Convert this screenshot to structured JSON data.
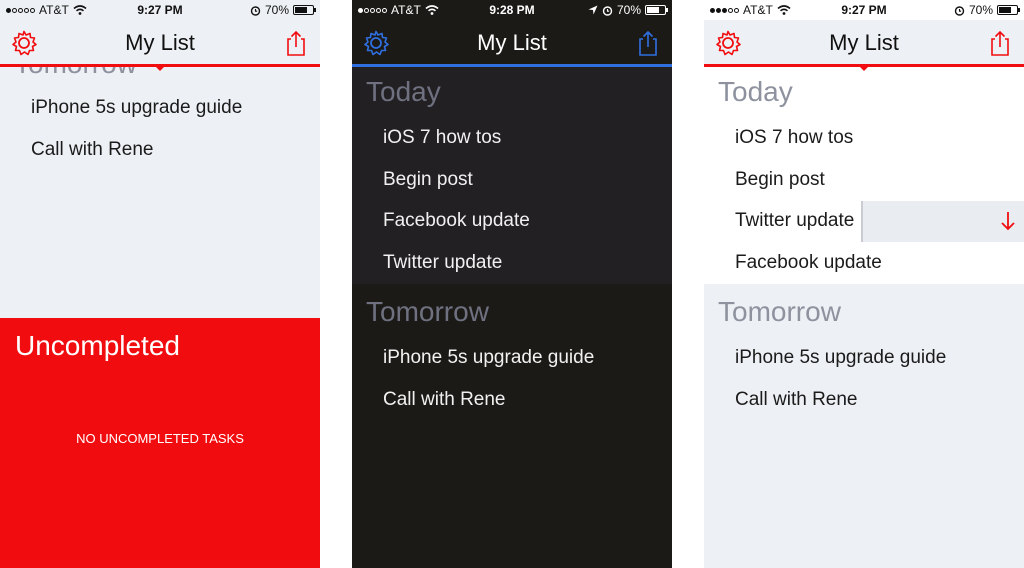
{
  "phones": [
    {
      "status": {
        "carrier": "AT&T",
        "time": "9:27 PM",
        "battery": "70%",
        "battery_level": 0.7
      },
      "nav": {
        "title": "My List"
      },
      "partial_section": "Tomorrow",
      "items": [
        "iPhone 5s upgrade guide",
        "Call with Rene"
      ],
      "uncompleted": {
        "title": "Uncompleted",
        "empty_text": "NO UNCOMPLETED TASKS"
      }
    },
    {
      "status": {
        "carrier": "AT&T",
        "time": "9:28 PM",
        "battery": "70%",
        "battery_level": 0.7
      },
      "nav": {
        "title": "My List"
      },
      "sections": [
        {
          "title": "Today",
          "items": [
            "iOS 7 how tos",
            "Begin post",
            "Facebook update",
            "Twitter update"
          ]
        },
        {
          "title": "Tomorrow",
          "items": [
            "iPhone 5s upgrade guide",
            "Call with Rene"
          ]
        }
      ]
    },
    {
      "status": {
        "carrier": "AT&T",
        "time": "9:27 PM",
        "battery": "70%",
        "battery_level": 0.7
      },
      "nav": {
        "title": "My List"
      },
      "sections": [
        {
          "title": "Today",
          "items": [
            "iOS 7 how tos",
            "Begin post",
            "Twitter update",
            "Facebook update"
          ]
        },
        {
          "title": "Tomorrow",
          "items": [
            "iPhone 5s upgrade guide",
            "Call with Rene"
          ]
        }
      ]
    }
  ],
  "colors": {
    "accent_red": "#f10d0f",
    "accent_blue": "#2f6fe0",
    "dark_bg": "#1c1a17",
    "light_bg": "#edf0f4"
  },
  "icons": [
    "signal-dots-icon",
    "wifi-icon",
    "location-icon",
    "alarm-icon",
    "battery-icon",
    "gear-icon",
    "share-icon",
    "down-arrow-icon"
  ]
}
